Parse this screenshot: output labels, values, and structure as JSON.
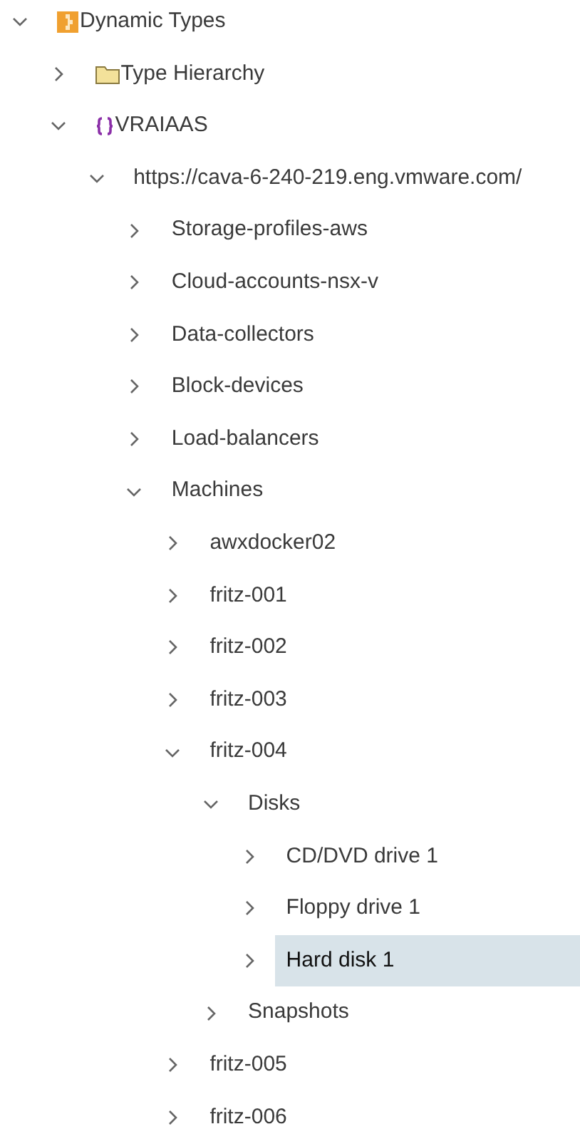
{
  "tree": [
    {
      "label": "Dynamic Types",
      "kind": "module",
      "expanded": true,
      "selected": false,
      "children": [
        {
          "label": "Type Hierarchy",
          "kind": "folder",
          "expanded": false,
          "selected": false
        },
        {
          "label": "VRAIAAS",
          "kind": "braces",
          "expanded": true,
          "selected": false,
          "children": [
            {
              "label": "https://cava-6-240-219.eng.vmware.com/",
              "expanded": true,
              "selected": false,
              "children": [
                {
                  "label": "Storage-profiles-aws",
                  "expanded": false,
                  "selected": false
                },
                {
                  "label": "Cloud-accounts-nsx-v",
                  "expanded": false,
                  "selected": false
                },
                {
                  "label": "Data-collectors",
                  "expanded": false,
                  "selected": false
                },
                {
                  "label": "Block-devices",
                  "expanded": false,
                  "selected": false
                },
                {
                  "label": "Load-balancers",
                  "expanded": false,
                  "selected": false
                },
                {
                  "label": "Machines",
                  "expanded": true,
                  "selected": false,
                  "children": [
                    {
                      "label": "awxdocker02",
                      "expanded": false,
                      "selected": false
                    },
                    {
                      "label": "fritz-001",
                      "expanded": false,
                      "selected": false
                    },
                    {
                      "label": "fritz-002",
                      "expanded": false,
                      "selected": false
                    },
                    {
                      "label": "fritz-003",
                      "expanded": false,
                      "selected": false
                    },
                    {
                      "label": "fritz-004",
                      "expanded": true,
                      "selected": false,
                      "children": [
                        {
                          "label": "Disks",
                          "expanded": true,
                          "selected": false,
                          "children": [
                            {
                              "label": "CD/DVD drive 1",
                              "expanded": false,
                              "selected": false
                            },
                            {
                              "label": "Floppy drive 1",
                              "expanded": false,
                              "selected": false
                            },
                            {
                              "label": "Hard disk 1",
                              "expanded": false,
                              "selected": true
                            }
                          ]
                        },
                        {
                          "label": "Snapshots",
                          "expanded": false,
                          "selected": false
                        }
                      ]
                    },
                    {
                      "label": "fritz-005",
                      "expanded": false,
                      "selected": false
                    },
                    {
                      "label": "fritz-006",
                      "expanded": false,
                      "selected": false
                    }
                  ]
                }
              ]
            }
          ]
        }
      ]
    }
  ]
}
